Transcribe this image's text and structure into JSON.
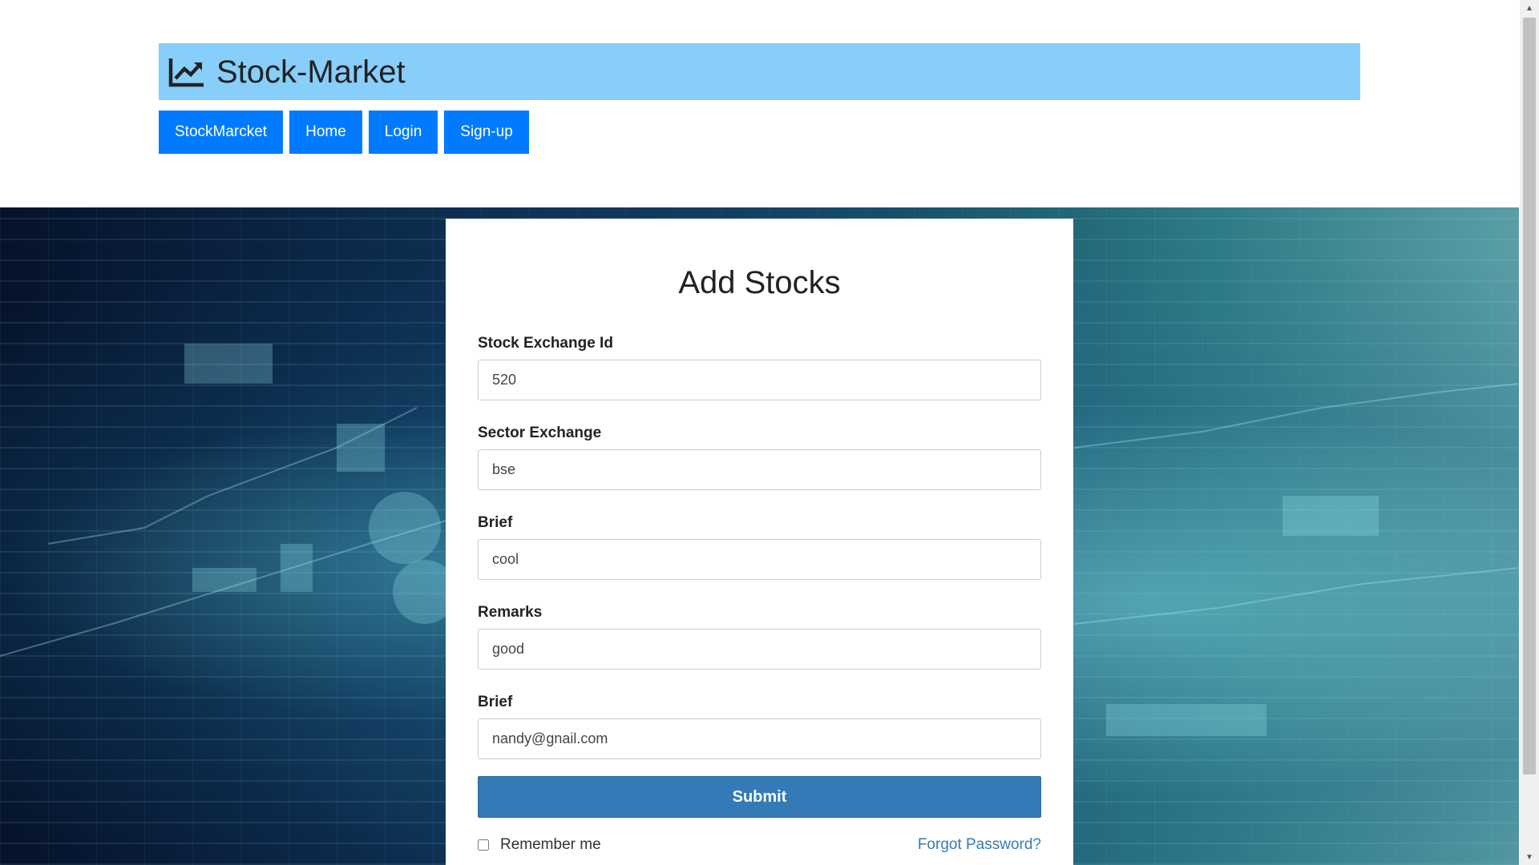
{
  "header": {
    "brand_title": "Stock-Market",
    "brand_icon": "chart-line-icon",
    "brand_color": "#87cefa"
  },
  "nav": {
    "items": [
      {
        "label": "StockMarcket"
      },
      {
        "label": "Home"
      },
      {
        "label": "Login"
      },
      {
        "label": "Sign-up"
      }
    ],
    "button_color": "#007bff"
  },
  "form": {
    "title": "Add Stocks",
    "fields": [
      {
        "label": "Stock Exchange Id",
        "value": "520"
      },
      {
        "label": "Sector Exchange",
        "value": "bse"
      },
      {
        "label": "Brief",
        "value": "cool"
      },
      {
        "label": "Remarks",
        "value": "good"
      },
      {
        "label": "Brief",
        "value": "nandy@gnail.com"
      }
    ],
    "submit_label": "Submit",
    "submit_color": "#337ab7",
    "remember_label": "Remember me",
    "remember_checked": false,
    "forgot_label": "Forgot Password?"
  }
}
